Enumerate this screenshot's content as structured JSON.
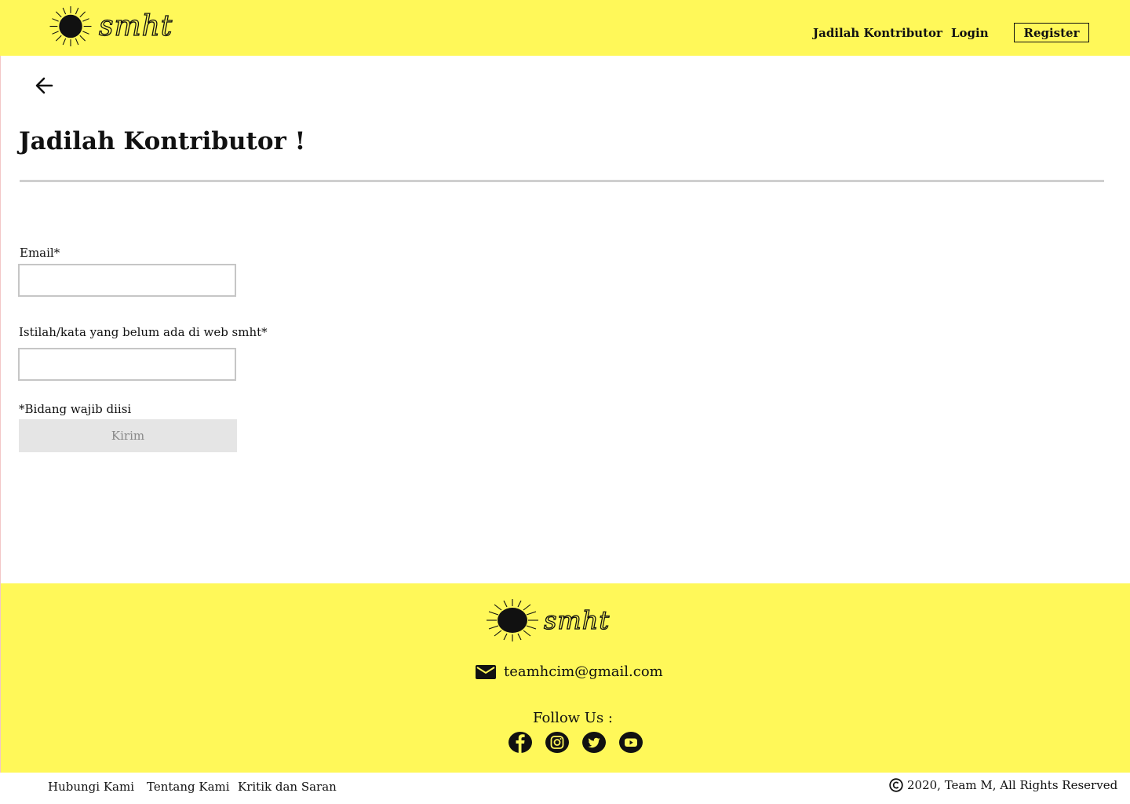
{
  "header": {
    "logo_text": "smht",
    "nav": {
      "contributor": "Jadilah Kontributor",
      "login": "Login",
      "register": "Register"
    }
  },
  "page": {
    "title": "Jadilah Kontributor !"
  },
  "form": {
    "email_label": "Email*",
    "email_value": "",
    "term_label": "Istilah/kata yang belum ada di web smht*",
    "term_value": "",
    "required_note": "*Bidang wajib diisi",
    "submit_label": "Kirim"
  },
  "footer": {
    "logo_text": "smht",
    "email": "teamhcim@gmail.com",
    "follow_label": "Follow Us :",
    "social_icons": [
      "facebook-icon",
      "instagram-icon",
      "twitter-icon",
      "youtube-icon"
    ]
  },
  "bottom_bar": {
    "links": [
      "Hubungi Kami",
      "Tentang Kami",
      "Kritik dan Saran"
    ],
    "copyright": "2020, Team M, All Rights Reserved"
  },
  "colors": {
    "brand_yellow": "#fff859",
    "text": "#111111",
    "rule": "#cfcfcf",
    "button_disabled": "#e5e5e5"
  }
}
